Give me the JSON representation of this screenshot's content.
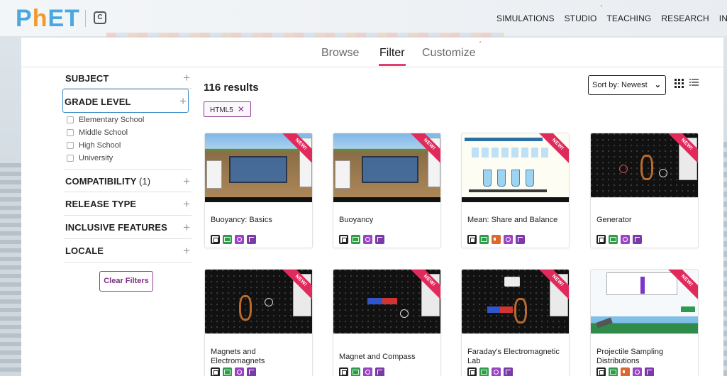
{
  "header": {
    "logo_text": "PhET",
    "nav": [
      "SIMULATIONS",
      "STUDIO",
      "TEACHING",
      "RESEARCH",
      "INITI"
    ]
  },
  "tabs": [
    {
      "label": "Browse",
      "active": false
    },
    {
      "label": "Filter",
      "active": true
    },
    {
      "label": "Customize",
      "active": false
    }
  ],
  "sidebar": {
    "facets": [
      {
        "label": "SUBJECT",
        "count": ""
      },
      {
        "label": "GRADE LEVEL",
        "count": ""
      },
      {
        "label": "COMPATIBILITY",
        "count": "(1)"
      },
      {
        "label": "RELEASE TYPE",
        "count": ""
      },
      {
        "label": "INCLUSIVE FEATURES",
        "count": ""
      },
      {
        "label": "LOCALE",
        "count": ""
      }
    ],
    "grade_options": [
      "Elementary School",
      "Middle School",
      "High School",
      "University"
    ],
    "clear_label": "Clear Filters"
  },
  "results": {
    "count_text": "116 results",
    "chip": "HTML5",
    "sort_label": "Sort by: Newest"
  },
  "cards": [
    {
      "title": "Buoyancy: Basics",
      "badge": "NEW!",
      "icons": [
        "html5-icon",
        "keyboard-icon",
        "zoom-icon",
        "interactive-description-icon"
      ]
    },
    {
      "title": "Buoyancy",
      "badge": "NEW!",
      "icons": [
        "html5-icon",
        "keyboard-icon",
        "zoom-icon",
        "interactive-description-icon"
      ]
    },
    {
      "title": "Mean: Share and Balance",
      "badge": "NEW!",
      "icons": [
        "html5-icon",
        "keyboard-icon",
        "sound-icon",
        "zoom-icon",
        "interactive-description-icon"
      ]
    },
    {
      "title": "Generator",
      "badge": "NEW!",
      "icons": [
        "html5-icon",
        "keyboard-icon",
        "zoom-icon",
        "interactive-description-icon"
      ]
    },
    {
      "title": "Magnets and Electromagnets",
      "badge": "NEW!",
      "icons": [
        "html5-icon",
        "keyboard-icon",
        "zoom-icon",
        "interactive-description-icon"
      ]
    },
    {
      "title": "Magnet and Compass",
      "badge": "NEW!",
      "icons": [
        "html5-icon",
        "keyboard-icon",
        "zoom-icon",
        "interactive-description-icon"
      ]
    },
    {
      "title": "Faraday's Electromagnetic Lab",
      "badge": "NEW!",
      "icons": [
        "html5-icon",
        "keyboard-icon",
        "zoom-icon",
        "interactive-description-icon"
      ]
    },
    {
      "title": "Projectile Sampling Distributions",
      "badge": "NEW!",
      "icons": [
        "html5-icon",
        "keyboard-icon",
        "sound-icon",
        "zoom-icon",
        "interactive-description-icon"
      ]
    }
  ],
  "colors": {
    "accent": "#e23d6c",
    "brand_purple": "#8a3e8e",
    "focus_blue": "#3b8cc7"
  }
}
